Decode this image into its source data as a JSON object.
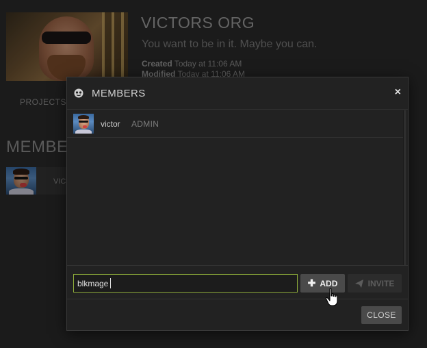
{
  "org": {
    "name": "VICTORS ORG",
    "tagline": "You want to be in it. Maybe you can.",
    "created_label": "Created",
    "created_value": "Today at 11:06 AM",
    "modified_label": "Modified",
    "modified_value": "Today at 11:06 AM"
  },
  "background": {
    "tab_projects": "PROJECTS",
    "section_title": "MEMBE",
    "member_name": "VIC"
  },
  "modal": {
    "title": "MEMBERS",
    "close_icon": "×",
    "members": [
      {
        "name": "victor",
        "role": "ADMIN"
      }
    ],
    "input_value": "blkmage",
    "add_label": "ADD",
    "invite_label": "INVITE",
    "close_label": "CLOSE"
  },
  "colors": {
    "input_border": "#8fae3a",
    "button_bg": "#4a4a4a",
    "modal_bg": "#222222"
  }
}
